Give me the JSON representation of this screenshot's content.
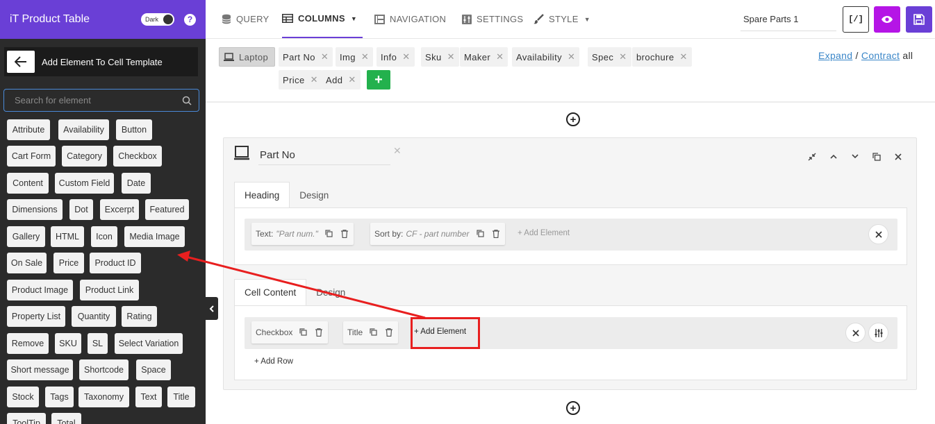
{
  "sidebar": {
    "app_title": "iT Product Table",
    "theme_toggle_label": "Dark",
    "help_label": "?",
    "panel_title": "Add Element To Cell Template",
    "search_placeholder": "Search for element",
    "elements": [
      "Attribute",
      "Availability",
      "Button",
      "Cart Form",
      "Category",
      "Checkbox",
      "Content",
      "Custom Field",
      "Date",
      "Dimensions",
      "Dot",
      "Excerpt",
      "Featured",
      "Gallery",
      "HTML",
      "Icon",
      "Media Image",
      "On Sale",
      "Price",
      "Product ID",
      "Product Image",
      "Product Link",
      "Property List",
      "Quantity",
      "Rating",
      "Remove",
      "SKU",
      "SL",
      "Select Variation",
      "Short message",
      "Shortcode",
      "Space",
      "Stock",
      "Tags",
      "Taxonomy",
      "Text",
      "Title",
      "ToolTip",
      "Total"
    ]
  },
  "topbar": {
    "tabs": [
      {
        "label": "QUERY",
        "icon": "database-icon"
      },
      {
        "label": "COLUMNS",
        "icon": "table-icon",
        "active": true,
        "caret": "▼"
      },
      {
        "label": "NAVIGATION",
        "icon": "navigation-icon"
      },
      {
        "label": "SETTINGS",
        "icon": "settings-sliders-icon"
      },
      {
        "label": "STYLE",
        "icon": "brush-icon",
        "caret": "▼"
      }
    ],
    "table_name": "Spare Parts 1",
    "shortcode_label": "[/]",
    "colors": {
      "accent": "#6a3fd6",
      "preview": "#b515e6",
      "add": "#23b14d"
    }
  },
  "columns": {
    "device": "Laptop",
    "tags": [
      "Part No",
      "Img",
      "Info",
      "Sku",
      "Maker",
      "Availability",
      "Spec",
      "brochure",
      "Price",
      "Add"
    ],
    "expand_label": "Expand",
    "separator": "/",
    "contract_label": "Contract",
    "all_label": "all"
  },
  "column_card": {
    "name": "Part No",
    "heading_tabs": [
      "Heading",
      "Design"
    ],
    "heading_elements": [
      {
        "label": "Text:",
        "value": "\"Part num.\""
      },
      {
        "label": "Sort by:",
        "value": "CF - part number"
      }
    ],
    "add_element_label": "+ Add Element",
    "cell_tabs": [
      "Cell Content",
      "Design"
    ],
    "cell_elements": [
      "Checkbox",
      "Title"
    ],
    "cell_add_element_label": "+ Add Element",
    "add_row_label": "+ Add Row"
  }
}
